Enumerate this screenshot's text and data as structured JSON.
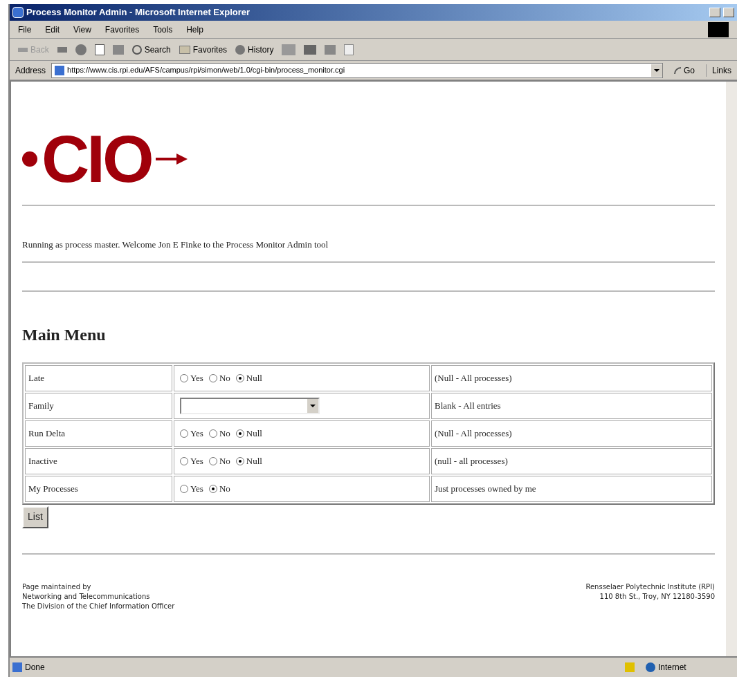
{
  "window": {
    "title": "Process Monitor Admin - Microsoft Internet Explorer"
  },
  "menu": [
    "File",
    "Edit",
    "View",
    "Favorites",
    "Tools",
    "Help"
  ],
  "toolbar": {
    "back": "Back",
    "search": "Search",
    "favorites": "Favorites",
    "history": "History"
  },
  "address": {
    "label": "Address",
    "value": "https://www.cis.rpi.edu/AFS/campus/rpi/simon/web/1.0/cgi-bin/process_monitor.cgi",
    "go": "Go",
    "links": "Links"
  },
  "logo": {
    "text": "CIO"
  },
  "welcome": "Running as process master. Welcome Jon E Finke to the Process Monitor Admin tool",
  "heading": "Main Menu",
  "rows": [
    {
      "label": "Late",
      "kind": "radio",
      "options": [
        {
          "label": "Yes",
          "selected": false
        },
        {
          "label": "No",
          "selected": false
        },
        {
          "label": "Null",
          "selected": true
        }
      ],
      "note": "(Null - All processes)"
    },
    {
      "label": "Family",
      "kind": "select",
      "note": "Blank - All entries"
    },
    {
      "label": "Run Delta",
      "kind": "radio",
      "options": [
        {
          "label": "Yes",
          "selected": false
        },
        {
          "label": "No",
          "selected": false
        },
        {
          "label": "Null",
          "selected": true
        }
      ],
      "note": "(Null - All processes)"
    },
    {
      "label": "Inactive",
      "kind": "radio",
      "options": [
        {
          "label": "Yes",
          "selected": false
        },
        {
          "label": "No",
          "selected": false
        },
        {
          "label": "Null",
          "selected": true
        }
      ],
      "note": "(null - all processes)"
    },
    {
      "label": "My Processes",
      "kind": "radio",
      "options": [
        {
          "label": "Yes",
          "selected": false
        },
        {
          "label": "No",
          "selected": true
        }
      ],
      "note": "Just processes owned by me"
    }
  ],
  "list_button": "List",
  "footer": {
    "left": [
      "Page maintained by",
      "Networking and Telecommunications",
      "The Division of the Chief Information Officer"
    ],
    "right": [
      "Rensselaer Polytechnic Institute (RPI)",
      "110 8th St., Troy, NY 12180-3590"
    ]
  },
  "status_bar": {
    "text": "Done",
    "zone": "Internet"
  }
}
